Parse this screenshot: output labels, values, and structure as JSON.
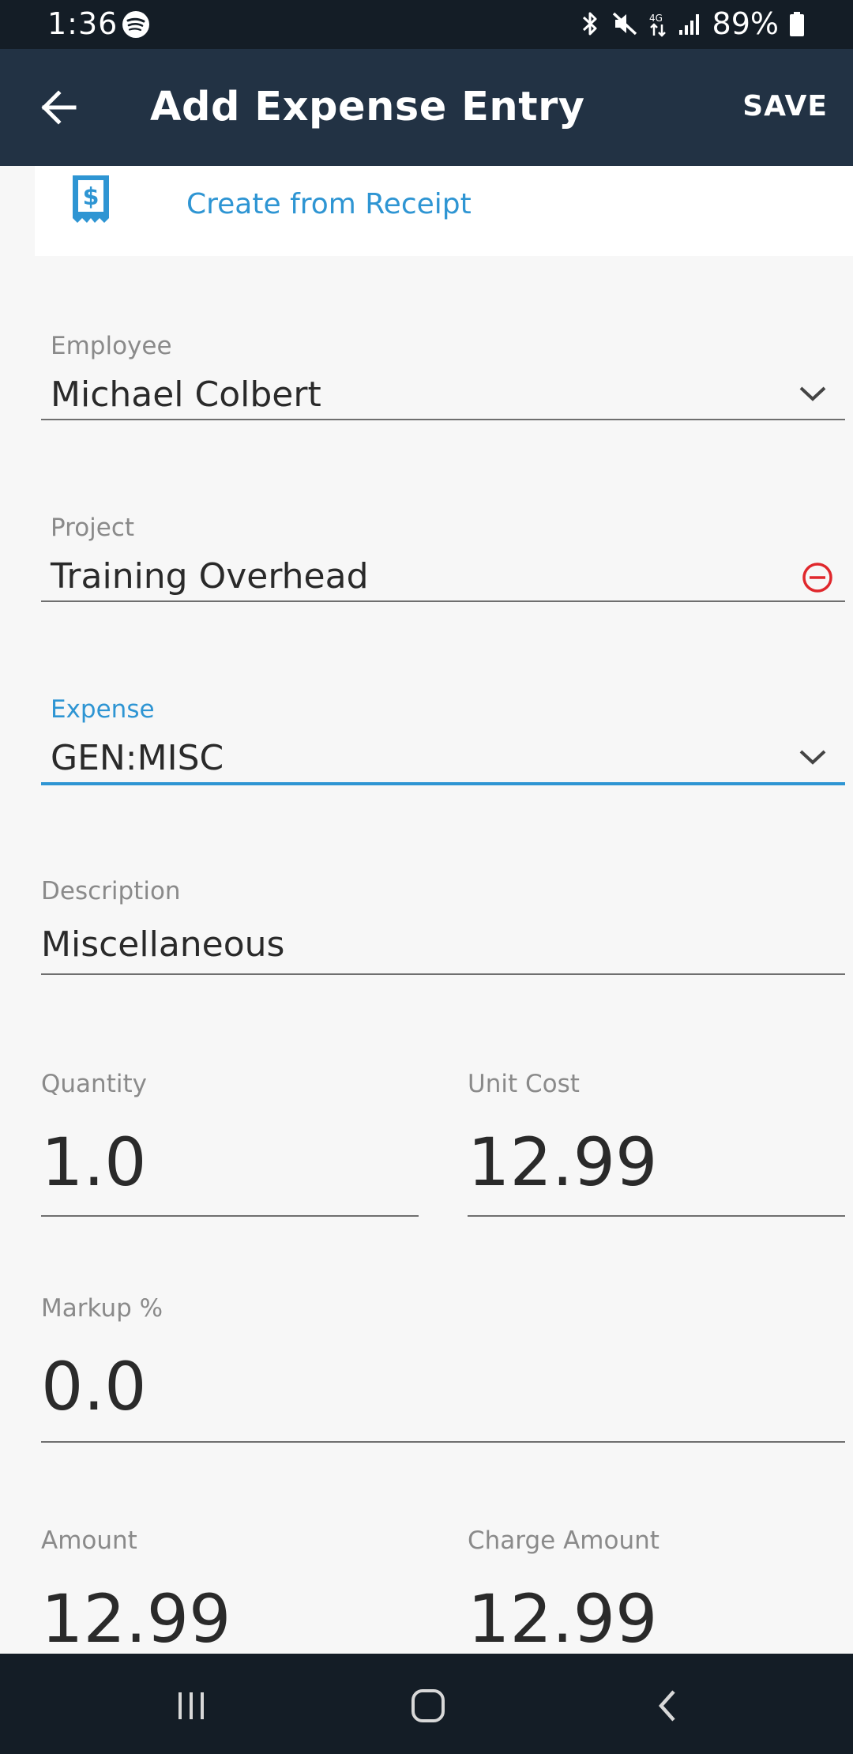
{
  "status_bar": {
    "time": "1:36",
    "battery": "89%"
  },
  "app_bar": {
    "title": "Add Expense Entry",
    "save_label": "SAVE"
  },
  "receipt": {
    "label": "Create from Receipt"
  },
  "fields": {
    "employee": {
      "label": "Employee",
      "value": "Michael Colbert"
    },
    "project": {
      "label": "Project",
      "value": "Training Overhead"
    },
    "expense": {
      "label": "Expense",
      "value": "GEN:MISC"
    },
    "description": {
      "label": "Description",
      "value": "Miscellaneous"
    },
    "quantity": {
      "label": "Quantity",
      "value": "1.0"
    },
    "unit_cost": {
      "label": "Unit Cost",
      "value": "12.99"
    },
    "markup": {
      "label": "Markup %",
      "value": "0.0"
    },
    "amount": {
      "label": "Amount",
      "value": "12.99"
    },
    "charge_amount": {
      "label": "Charge Amount",
      "value": "12.99"
    }
  },
  "colors": {
    "accent": "#2e95d3",
    "app_bar": "#223244",
    "status_bar": "#141d26",
    "error": "#e0272c"
  },
  "icons": {
    "back": "arrow-left-icon",
    "receipt": "receipt-dollar-icon",
    "dropdown": "chevron-down-icon",
    "clear": "remove-circle-icon"
  }
}
